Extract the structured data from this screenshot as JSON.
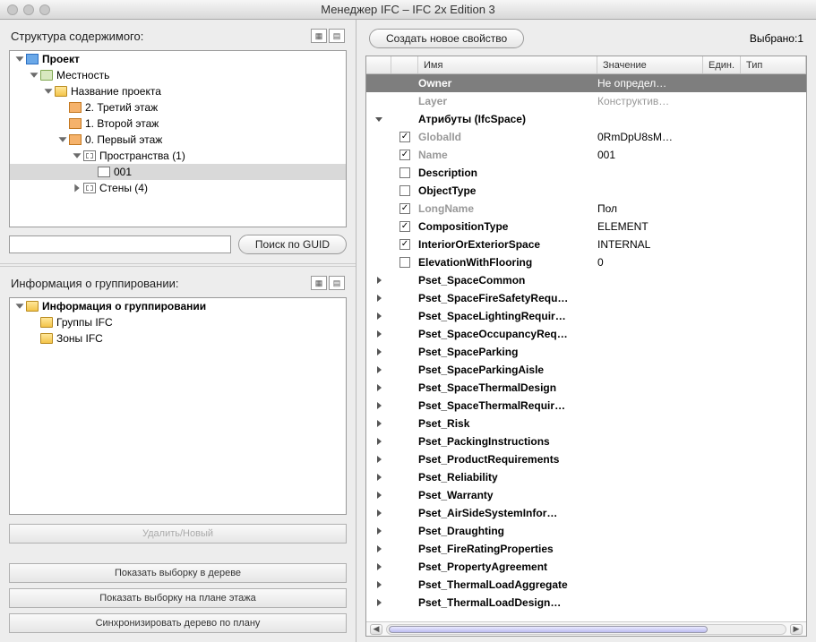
{
  "window": {
    "title": "Менеджер IFC – IFC 2x Edition 3"
  },
  "left": {
    "structure": {
      "heading": "Структура содержимого:",
      "search_placeholder": "",
      "search_button": "Поиск по GUID",
      "tree": [
        {
          "indent": 0,
          "disclosure": "open",
          "icon": "project",
          "label": "Проект"
        },
        {
          "indent": 1,
          "disclosure": "open",
          "icon": "site",
          "label": "Местность"
        },
        {
          "indent": 2,
          "disclosure": "open",
          "icon": "folder",
          "label": "Название проекта"
        },
        {
          "indent": 3,
          "disclosure": "none",
          "icon": "storey",
          "label": "2. Третий этаж"
        },
        {
          "indent": 3,
          "disclosure": "none",
          "icon": "storey",
          "label": "1. Второй этаж"
        },
        {
          "indent": 3,
          "disclosure": "open",
          "icon": "storey",
          "label": "0. Первый этаж"
        },
        {
          "indent": 4,
          "disclosure": "open",
          "icon": "group",
          "label": "Пространства (1)"
        },
        {
          "indent": 5,
          "disclosure": "none",
          "icon": "space",
          "label": "001",
          "selected": true
        },
        {
          "indent": 4,
          "disclosure": "closed",
          "icon": "group",
          "label": "Стены (4)"
        }
      ]
    },
    "grouping": {
      "heading": "Информация о группировании:",
      "tree": [
        {
          "indent": 0,
          "disclosure": "open",
          "icon": "folder",
          "label": "Информация о группировании"
        },
        {
          "indent": 1,
          "disclosure": "none",
          "icon": "folder",
          "label": "Группы IFC"
        },
        {
          "indent": 1,
          "disclosure": "none",
          "icon": "folder",
          "label": "Зоны IFC"
        }
      ]
    },
    "buttons": {
      "delete_new": "Удалить/Новый",
      "show_in_tree": "Показать выборку в дереве",
      "show_on_plan": "Показать выборку на плане этажа",
      "sync_tree": "Синхронизировать дерево по плану"
    }
  },
  "right": {
    "create_btn": "Создать новое свойство",
    "selected_label": "Выбрано:1",
    "columns": {
      "name": "Имя",
      "value": "Значение",
      "unit": "Един.",
      "type": "Тип"
    },
    "rows": [
      {
        "kind": "dark",
        "name": "Owner",
        "value": "Не определ…"
      },
      {
        "kind": "light",
        "name": "Layer",
        "value": "Конструктив…"
      },
      {
        "kind": "section",
        "expander": "open",
        "name": "Атрибуты (IfcSpace)"
      },
      {
        "kind": "attr",
        "checked": true,
        "name": "GlobalId",
        "value": "0RmDpU8sM…",
        "dim": true
      },
      {
        "kind": "attr",
        "checked": true,
        "name": "Name",
        "value": "001",
        "dim": true
      },
      {
        "kind": "attr",
        "checked": false,
        "name": "Description",
        "value": ""
      },
      {
        "kind": "attr",
        "checked": false,
        "name": "ObjectType",
        "value": ""
      },
      {
        "kind": "attr",
        "checked": true,
        "name": "LongName",
        "value": "Пол",
        "dim": true
      },
      {
        "kind": "attr",
        "checked": true,
        "name": "CompositionType",
        "value": "ELEMENT"
      },
      {
        "kind": "attr",
        "checked": true,
        "name": "InteriorOrExteriorSpace",
        "value": "INTERNAL"
      },
      {
        "kind": "attr",
        "checked": false,
        "name": "ElevationWithFlooring",
        "value": "0"
      },
      {
        "kind": "pset",
        "name": "Pset_SpaceCommon"
      },
      {
        "kind": "pset",
        "name": "Pset_SpaceFireSafetyRequ…"
      },
      {
        "kind": "pset",
        "name": "Pset_SpaceLightingRequir…"
      },
      {
        "kind": "pset",
        "name": "Pset_SpaceOccupancyReq…"
      },
      {
        "kind": "pset",
        "name": "Pset_SpaceParking"
      },
      {
        "kind": "pset",
        "name": "Pset_SpaceParkingAisle"
      },
      {
        "kind": "pset",
        "name": "Pset_SpaceThermalDesign"
      },
      {
        "kind": "pset",
        "name": "Pset_SpaceThermalRequir…"
      },
      {
        "kind": "pset",
        "name": "Pset_Risk"
      },
      {
        "kind": "pset",
        "name": "Pset_PackingInstructions"
      },
      {
        "kind": "pset",
        "name": "Pset_ProductRequirements"
      },
      {
        "kind": "pset",
        "name": "Pset_Reliability"
      },
      {
        "kind": "pset",
        "name": "Pset_Warranty"
      },
      {
        "kind": "pset",
        "name": "Pset_AirSideSystemInfor…"
      },
      {
        "kind": "pset",
        "name": "Pset_Draughting"
      },
      {
        "kind": "pset",
        "name": "Pset_FireRatingProperties"
      },
      {
        "kind": "pset",
        "name": "Pset_PropertyAgreement"
      },
      {
        "kind": "pset",
        "name": "Pset_ThermalLoadAggregate"
      },
      {
        "kind": "pset",
        "name": "Pset_ThermalLoadDesign…"
      }
    ]
  }
}
